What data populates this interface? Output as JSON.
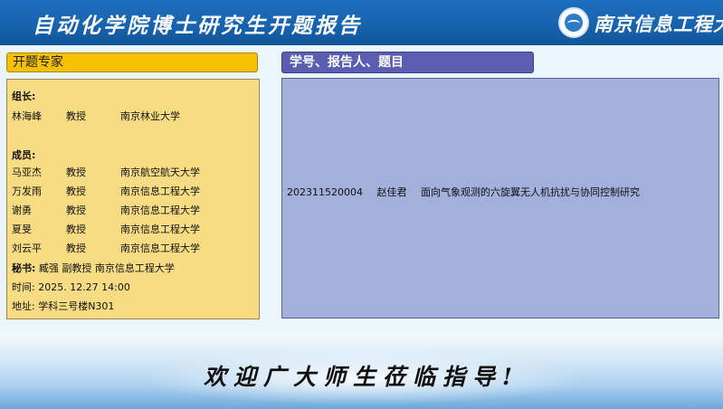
{
  "header": {
    "title": "自动化学院博士研究生开题报告",
    "university_logo_text": "南京信息工程大学",
    "background_color": "#1762ad",
    "logo_icon": "university-emblem-icon"
  },
  "left_panel": {
    "heading": "开题专家",
    "heading_color": "#f5c000",
    "body_color": "#f8dc84",
    "leader_label": "组长:",
    "leader": {
      "name": "林海峰",
      "title": "教授",
      "affiliation": "南京林业大学"
    },
    "members_label": "成员:",
    "members": [
      {
        "name": "马亚杰",
        "title": "教授",
        "affiliation": "南京航空航天大学"
      },
      {
        "name": "万发雨",
        "title": "教授",
        "affiliation": "南京信息工程大学"
      },
      {
        "name": "谢勇",
        "title": "教授",
        "affiliation": "南京信息工程大学"
      },
      {
        "name": "夏旻",
        "title": "教授",
        "affiliation": "南京信息工程大学"
      },
      {
        "name": "刘云平",
        "title": "教授",
        "affiliation": "南京信息工程大学"
      }
    ],
    "secretary_label": "秘书:",
    "secretary_value": "臧强  副教授  南京信息工程大学",
    "time_line": "时间: 2025. 12.27  14:00",
    "location_line": "地址: 学科三号楼N301"
  },
  "right_panel": {
    "heading": "学号、报告人、题目",
    "heading_color": "#5a5db0",
    "body_color": "#a3afdc",
    "student_id": "202311520004",
    "student_name": "赵佳君",
    "thesis_title": "面向气象观测的六旋翼无人机抗扰与协同控制研究"
  },
  "footer": {
    "welcome_text": "欢迎广大师生莅临指导!"
  }
}
